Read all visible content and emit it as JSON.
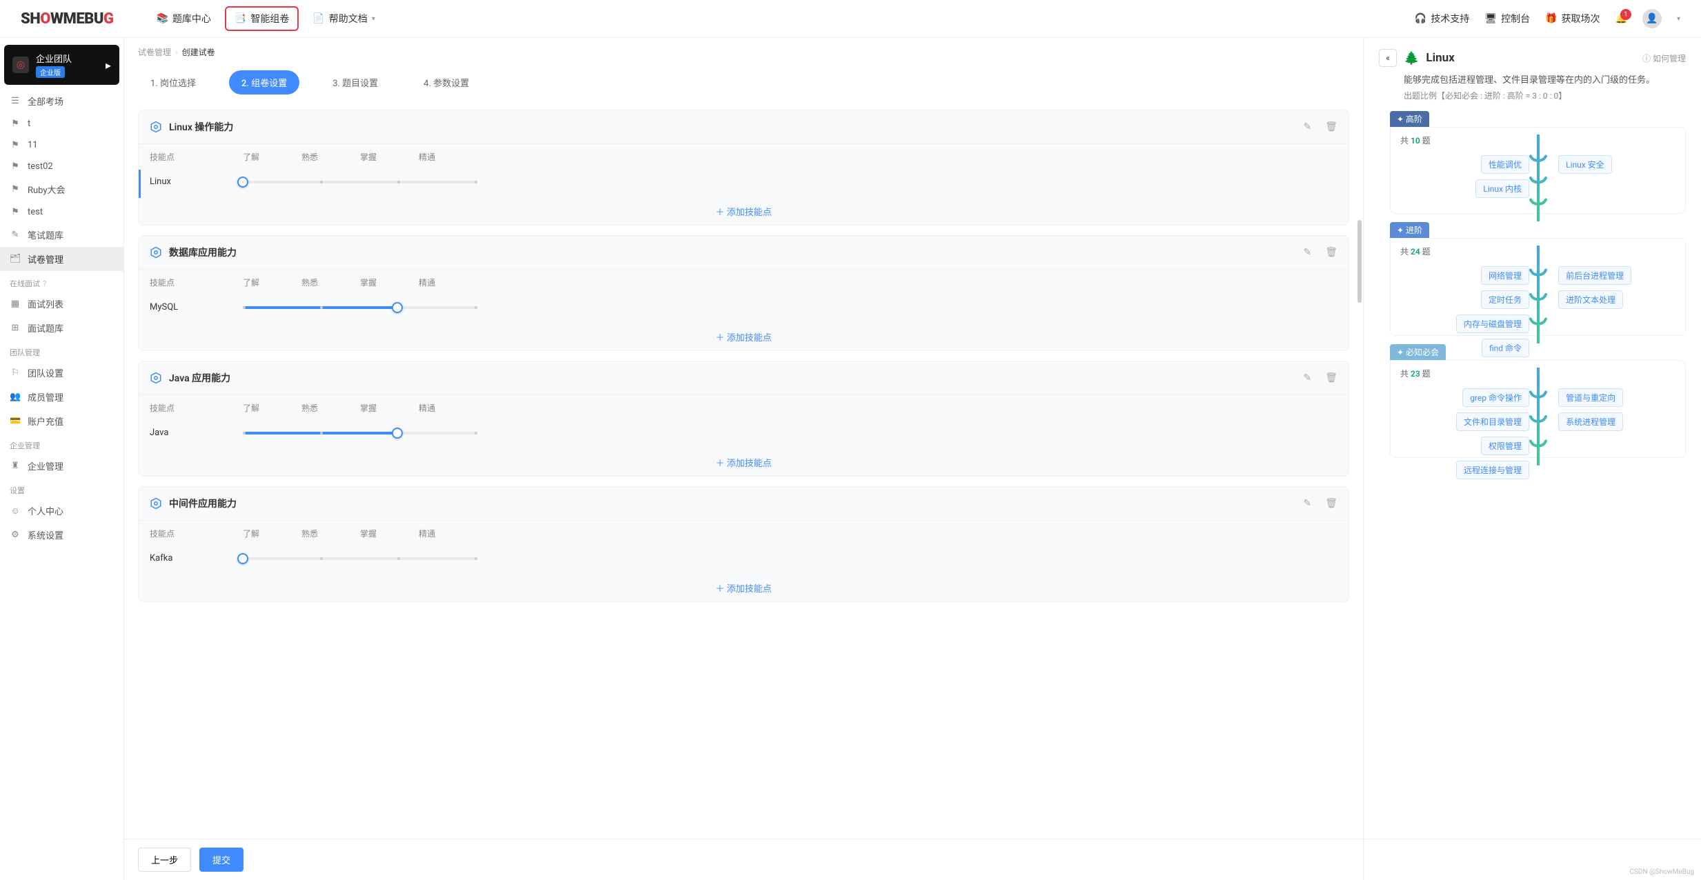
{
  "logo": {
    "p1": "SH",
    "p2": "O",
    "p3": "WMEBU",
    "p4": "G"
  },
  "topnav": {
    "items": [
      {
        "label": "题库中心",
        "icon": "library-icon"
      },
      {
        "label": "智能组卷",
        "icon": "layers-icon"
      },
      {
        "label": "帮助文档",
        "icon": "doc-icon"
      }
    ],
    "right": [
      {
        "label": "技术支持",
        "icon": "support-icon"
      },
      {
        "label": "控制台",
        "icon": "console-icon"
      },
      {
        "label": "获取场次",
        "icon": "gift-icon"
      }
    ],
    "bell_badge": "1"
  },
  "sidebar": {
    "team": {
      "name": "企业团队",
      "badge": "企业版"
    },
    "main": [
      {
        "label": "全部考场",
        "icon": "list-icon"
      },
      {
        "label": "t",
        "icon": "flag-icon"
      },
      {
        "label": "11",
        "icon": "flag-icon"
      },
      {
        "label": "test02",
        "icon": "flag-icon"
      },
      {
        "label": "Ruby大会",
        "icon": "flag-icon"
      },
      {
        "label": "test",
        "icon": "flag-icon"
      },
      {
        "label": "笔试题库",
        "icon": "edit-icon"
      },
      {
        "label": "试卷管理",
        "icon": "papers-icon"
      }
    ],
    "groups": [
      {
        "title": "在线面试",
        "items": [
          {
            "label": "面试列表",
            "icon": "calendar-icon"
          },
          {
            "label": "面试题库",
            "icon": "grid-icon"
          }
        ]
      },
      {
        "title": "团队管理",
        "items": [
          {
            "label": "团队设置",
            "icon": "team-icon"
          },
          {
            "label": "成员管理",
            "icon": "members-icon"
          },
          {
            "label": "账户充值",
            "icon": "wallet-icon"
          }
        ]
      },
      {
        "title": "企业管理",
        "items": [
          {
            "label": "企业管理",
            "icon": "org-icon"
          }
        ]
      },
      {
        "title": "设置",
        "items": [
          {
            "label": "个人中心",
            "icon": "user-icon"
          },
          {
            "label": "系统设置",
            "icon": "gear-icon"
          }
        ]
      }
    ]
  },
  "breadcrumb": {
    "parent": "试卷管理",
    "current": "创建试卷"
  },
  "steps": [
    {
      "label": "1. 岗位选择"
    },
    {
      "label": "2. 组卷设置"
    },
    {
      "label": "3. 题目设置"
    },
    {
      "label": "4. 参数设置"
    }
  ],
  "cards": [
    {
      "title": "Linux 操作能力",
      "skills": [
        {
          "name": "Linux",
          "progress": 0,
          "bordered": true
        }
      ]
    },
    {
      "title": "数据库应用能力",
      "skills": [
        {
          "name": "MySQL",
          "progress": 66,
          "bordered": false
        }
      ]
    },
    {
      "title": "Java 应用能力",
      "skills": [
        {
          "name": "Java",
          "progress": 66,
          "bordered": false
        }
      ]
    },
    {
      "title": "中间件应用能力",
      "skills": [
        {
          "name": "Kafka",
          "progress": 0,
          "bordered": false
        }
      ]
    }
  ],
  "columns": {
    "c1": "技能点",
    "l1": "了解",
    "l2": "熟悉",
    "l3": "掌握",
    "l4": "精通"
  },
  "add_skill": "添加技能点",
  "footer": {
    "prev": "上一步",
    "submit": "提交"
  },
  "panel": {
    "title": "Linux",
    "help": "如何管理",
    "desc": "能够完成包括进程管理、文件目录管理等在内的入门级的任务。",
    "ratio": "出题比例【必知必会 : 进阶 : 高阶 = 3 : 0 : 0】",
    "levels": [
      {
        "tag": "高阶",
        "count_prefix": "共 ",
        "count": "10",
        "count_suffix": " 题",
        "left": [
          "性能调优",
          "Linux 内核"
        ],
        "right": [
          "Linux 安全"
        ]
      },
      {
        "tag": "进阶",
        "count_prefix": "共 ",
        "count": "24",
        "count_suffix": " 题",
        "left": [
          "网络管理",
          "定时任务",
          "内存与磁盘管理",
          "find 命令"
        ],
        "right": [
          "前后台进程管理",
          "进阶文本处理"
        ]
      },
      {
        "tag": "必知必会",
        "count_prefix": "共 ",
        "count": "23",
        "count_suffix": " 题",
        "left": [
          "grep 命令操作",
          "文件和目录管理",
          "权限管理",
          "远程连接与管理"
        ],
        "right": [
          "管道与重定向",
          "系统进程管理"
        ]
      }
    ]
  },
  "watermark": "CSDN @ShowMeBug"
}
